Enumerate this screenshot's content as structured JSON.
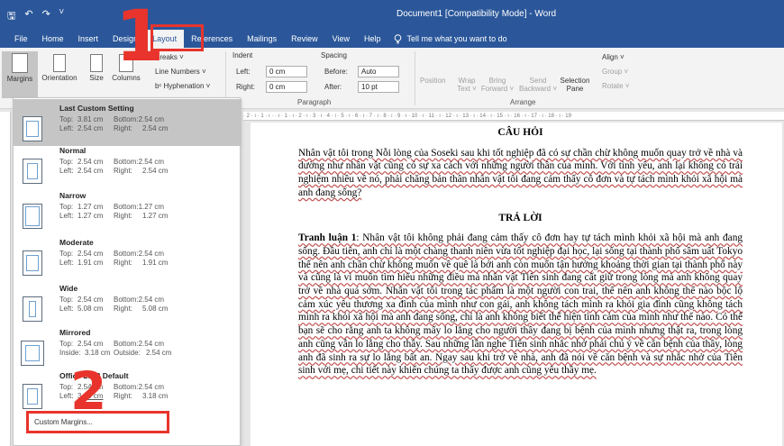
{
  "window": {
    "title": "Document1 [Compatibility Mode]  -  Word",
    "qat": [
      "🖫",
      "↶",
      "↷",
      "ᐯ"
    ]
  },
  "tabs": [
    "File",
    "Home",
    "Insert",
    "Design",
    "Layout",
    "References",
    "Mailings",
    "Review",
    "View",
    "Help"
  ],
  "active_tab": "Layout",
  "tell_me": "Tell me what you want to do",
  "ribbon": {
    "margins": "Margins",
    "orientation": "Orientation",
    "size": "Size",
    "columns": "Columns",
    "breaks": "Breaks ˅",
    "line_numbers": "Line Numbers ˅",
    "hyphenation": "bᶜ Hyphenation ˅",
    "indent_title": "Indent",
    "indent_left_label": "Left:",
    "indent_left_value": "0 cm",
    "indent_right_label": "Right:",
    "indent_right_value": "0 cm",
    "spacing_title": "Spacing",
    "spacing_before_label": "Before:",
    "spacing_before_value": "Auto",
    "spacing_after_label": "After:",
    "spacing_after_value": "10 pt",
    "paragraph_group": "Paragraph",
    "position": "Position",
    "wrap_text": "Wrap Text ˅",
    "bring_forward": "Bring Forward ˅",
    "send_backward": "Send Backward ˅",
    "selection_pane": "Selection Pane",
    "align": "Align ˅",
    "group": "Group ˅",
    "rotate": "Rotate ˅",
    "arrange_group": "Arrange"
  },
  "ruler_text": "· 2 · ı · 1 · ı ·  · ı · 1 · ı · 2 · ı · 3 · ı · 4 · ı · 5 · ı · 6 · ı · 7 · ı · 8 · ı · 9 · ı · 10 · ı · 11 · ı · 12 · ı · 13 · ı · 14 · ı · 15 · ı · 16 · ı · 17 · ı · 18 · ı · 19",
  "margins_menu": {
    "options": [
      {
        "name": "Last Custom Setting",
        "top": "Top:",
        "top_val": "3.81 cm",
        "bottom": "Bottom:",
        "bottom_val": "2.54 cm",
        "left": "Left:",
        "left_val": "2.54 cm",
        "right": "Right:",
        "right_val": "2.54 cm"
      },
      {
        "name": "Normal",
        "top": "Top:",
        "top_val": "2.54 cm",
        "bottom": "Bottom:",
        "bottom_val": "2.54 cm",
        "left": "Left:",
        "left_val": "2.54 cm",
        "right": "Right:",
        "right_val": "2.54 cm"
      },
      {
        "name": "Narrow",
        "top": "Top:",
        "top_val": "1.27 cm",
        "bottom": "Bottom:",
        "bottom_val": "1.27 cm",
        "left": "Left:",
        "left_val": "1.27 cm",
        "right": "Right:",
        "right_val": "1.27 cm"
      },
      {
        "name": "Moderate",
        "top": "Top:",
        "top_val": "2.54 cm",
        "bottom": "Bottom:",
        "bottom_val": "2.54 cm",
        "left": "Left:",
        "left_val": "1.91 cm",
        "right": "Right:",
        "right_val": "1.91 cm"
      },
      {
        "name": "Wide",
        "top": "Top:",
        "top_val": "2.54 cm",
        "bottom": "Bottom:",
        "bottom_val": "2.54 cm",
        "left": "Left:",
        "left_val": "5.08 cm",
        "right": "Right:",
        "right_val": "5.08 cm"
      },
      {
        "name": "Mirrored",
        "top": "Top:",
        "top_val": "2.54 cm",
        "bottom": "Bottom:",
        "bottom_val": "2.54 cm",
        "left": "Inside:",
        "left_val": "3.18 cm",
        "right": "Outside:",
        "right_val": "2.54 cm"
      },
      {
        "name": "Office 2003 Default",
        "top": "Top:",
        "top_val": "2.54 cm",
        "bottom": "Bottom:",
        "bottom_val": "2.54 cm",
        "left": "Left:",
        "left_val": "3.18 cm",
        "right": "Right:",
        "right_val": "3.18 cm"
      }
    ],
    "custom_margins": "Custom Margins..."
  },
  "annotations": {
    "step1": "1",
    "step2": "2"
  },
  "document": {
    "heading1": "CÂU HỎI",
    "question": "Nhân vật tôi trong Nỗi lòng của Soseki sau khi tốt nghiệp đã có sự chần chừ không muốn quay trở về nhà và dường như nhân vật cũng có sự xa cách với những người thân của mình. Với tình yêu, anh lại không có trải nghiệm nhiều về nó, phải chăng bản thân nhân vật tôi đang cảm thấy cô đơn và tự tách mình khỏi xã hội mà anh đang sống?",
    "heading2": "TRẢ LỜI",
    "answer_label": "Tranh luận 1",
    "answer": ": Nhân vật tôi không phải đang cảm thấy cô đơn hay tự tách mình khỏi xã hội mà anh đang sống. Đầu tiên, anh chỉ là một chàng thanh niên vừa tốt nghiệp đại học, lại sống tại thành phố sầm uất Tokyo thế nên anh chần chừ không muốn về quê là bởi anh còn muốn tận hưởng khoảng thời gian tại thành phố này và cũng là vì muốn tìm hiểu những điều mà nhân vật Tiên sinh đang cất giữ trong lòng mà anh không quay trở về nhà quá sớm. Nhân vật tôi trong tác phẩm là một người con trai, thế nên anh không thể nào bộc lộ cảm xúc yêu thương xa đình của mình như con gái, anh không tách mình ra khỏi gia đình cũng không tách mình ra khỏi xã hội mà anh đang sống, chỉ là anh không biết thể hiện tình cảm của mình như thế nào. Có thể bạn sẽ cho rằng anh ta không mấy lo lắng cho người thầy đang bị bệnh của mình nhưng thật ra, trong lòng anh cũng vẫn lo lắng cho thầy. Sau những lần nghe Tiên sinh nhắc nhở phải chú ý về căn bệnh của thầy, lòng anh đã sinh ra sự lo lắng bất an. Ngay sau khi trở về nhà, anh đã nói về căn bệnh và sự nhắc nhở của Tiên sinh với mẹ, chi tiết này khiến chúng ta thấy được anh cũng yêu thầy mẹ."
  }
}
